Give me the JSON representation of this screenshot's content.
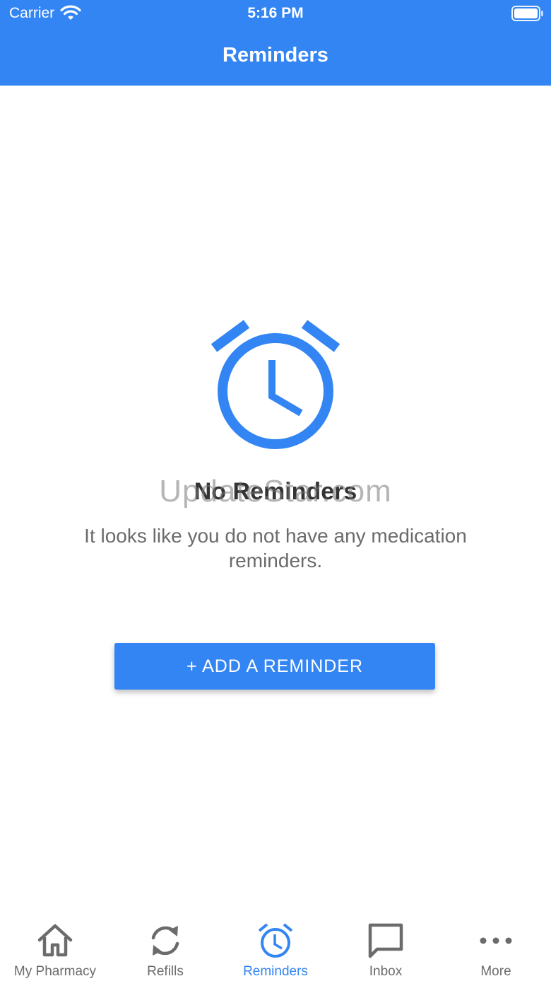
{
  "status_bar": {
    "carrier": "Carrier",
    "time": "5:16 PM",
    "icons": [
      "wifi-icon",
      "battery-icon"
    ]
  },
  "nav": {
    "title": "Reminders"
  },
  "empty_state": {
    "icon": "alarm-clock-icon",
    "title": "No Reminders",
    "message": "It looks like you do not have any medication reminders.",
    "watermark": "UpdateStar.com"
  },
  "add_button": {
    "label": "+ ADD A REMINDER"
  },
  "tab_bar": {
    "tabs": [
      {
        "label": "My Pharmacy",
        "icon": "home-icon",
        "active": false
      },
      {
        "label": "Refills",
        "icon": "refresh-icon",
        "active": false
      },
      {
        "label": "Reminders",
        "icon": "alarm-clock-icon",
        "active": true
      },
      {
        "label": "Inbox",
        "icon": "message-icon",
        "active": false
      },
      {
        "label": "More",
        "icon": "more-dots-icon",
        "active": false
      }
    ]
  },
  "colors": {
    "primary": "#3385f3",
    "inactive": "#6b6b6b",
    "title_text": "#333333"
  }
}
